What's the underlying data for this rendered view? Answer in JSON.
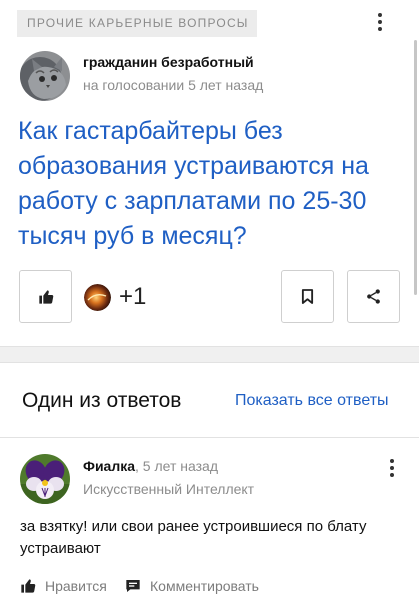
{
  "question": {
    "category": "ПРОЧИЕ КАРЬЕРНЫЕ ВОПРОСЫ",
    "author_name": "гражданин безработный",
    "author_meta": "на голосовании 5 лет назад",
    "title": "Как гастарбайтеры без образования устраиваются на работу с зарплатами по 25-30 тысяч руб в месяц?",
    "plus_count": "+1",
    "icons": {
      "menu": "more-vertical-icon",
      "like": "thumbs-up-icon",
      "bookmark": "bookmark-icon",
      "share": "share-icon"
    }
  },
  "answers": {
    "section_title": "Один из ответов",
    "show_all_label": "Показать все ответы",
    "answer": {
      "author_name": "Фиалка",
      "time": ", 5 лет назад",
      "rank": "Искусственный Интеллект",
      "text": "за взятку! или свои ранее устроившиеся по блату устраивают",
      "like_label": "Нравится",
      "comment_label": "Комментировать",
      "icons": {
        "menu": "more-vertical-icon",
        "like": "thumbs-up-icon",
        "comment": "comment-icon"
      }
    }
  },
  "colors": {
    "link": "#1f5fc4",
    "muted": "#8c8c8c",
    "tag_bg": "#ececec",
    "page_bg": "#f0f0f0"
  }
}
